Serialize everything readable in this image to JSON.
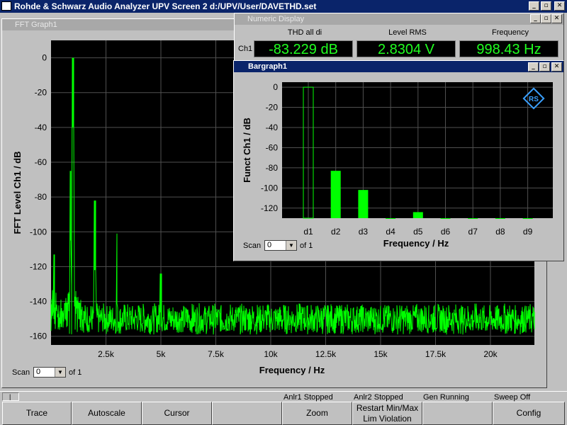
{
  "app": {
    "title": "Rohde & Schwarz Audio Analyzer UPV Screen 2  d:/UPV/User/DAVETHD.set"
  },
  "fft": {
    "panel_title": "FFT Graph1",
    "ylabel": "FFT Level Ch1 / dB",
    "xlabel": "Frequency / Hz",
    "yticks": [
      "0",
      "-20",
      "-40",
      "-60",
      "-80",
      "-100",
      "-120",
      "-140",
      "-160"
    ],
    "xticks": [
      "2.5k",
      "5k",
      "7.5k",
      "10k",
      "12.5k",
      "15k",
      "17.5k",
      "20k"
    ],
    "scan": {
      "label": "Scan",
      "value": "0",
      "of": "of 1"
    }
  },
  "numeric": {
    "panel_title": "Numeric Display",
    "channel": "Ch1",
    "headers": [
      "THD all di",
      "Level RMS",
      "Frequency"
    ],
    "values": [
      "-83.229 dB",
      "2.8304 V",
      "998.43 Hz"
    ]
  },
  "bargraph": {
    "panel_title": "Bargraph1",
    "ylabel": "Funct Ch1 / dB",
    "xlabel": "Frequency / Hz",
    "scan": {
      "label": "Scan",
      "value": "0",
      "of": "of 1"
    }
  },
  "chart_data": [
    {
      "type": "line",
      "title": "",
      "xlabel": "Frequency / Hz",
      "ylabel": "FFT Level Ch1 / dB",
      "xlim": [
        0,
        22000
      ],
      "ylim": [
        -165,
        10
      ],
      "x_tick_labels": [
        "2.5k",
        "5k",
        "7.5k",
        "10k",
        "12.5k",
        "15k",
        "17.5k",
        "20k"
      ],
      "grid": true,
      "line_color": "#00ff00",
      "noise_floor_db": -150,
      "peaks": [
        {
          "x": 1000,
          "y": 0
        },
        {
          "x": 2000,
          "y": -82
        },
        {
          "x": 3000,
          "y": -101
        },
        {
          "x": 5000,
          "y": -124
        },
        {
          "x": 150,
          "y": -113
        },
        {
          "x": 900,
          "y": -65
        }
      ]
    },
    {
      "type": "bar",
      "title": "",
      "xlabel": "Frequency / Hz",
      "ylabel": "Funct Ch1 / dB",
      "categories": [
        "d1",
        "d2",
        "d3",
        "d4",
        "d5",
        "d6",
        "d7",
        "d8",
        "d9"
      ],
      "values": [
        0,
        -83,
        -102,
        -130,
        -124,
        -130,
        -130,
        -130,
        -130
      ],
      "yticks": [
        "0",
        "-20",
        "-40",
        "-60",
        "-80",
        "-100",
        "-120"
      ],
      "ylim": [
        -130,
        5
      ],
      "grid": true,
      "bar_color": "#00ff00"
    }
  ],
  "status": {
    "anlr1": "Anlr1 Stopped",
    "anlr2": "Anlr2 Stopped",
    "gen": "Gen Running",
    "sweep": "Sweep Off"
  },
  "softkeys": [
    "Trace",
    "Autoscale",
    "Cursor",
    "",
    "Zoom",
    "Restart Min/Max Lim Violation",
    "",
    "Config"
  ],
  "colors": {
    "title_active": "#0a246a",
    "plot_bg": "#000000",
    "trace": "#00ff00",
    "readout": "#20ff20"
  }
}
